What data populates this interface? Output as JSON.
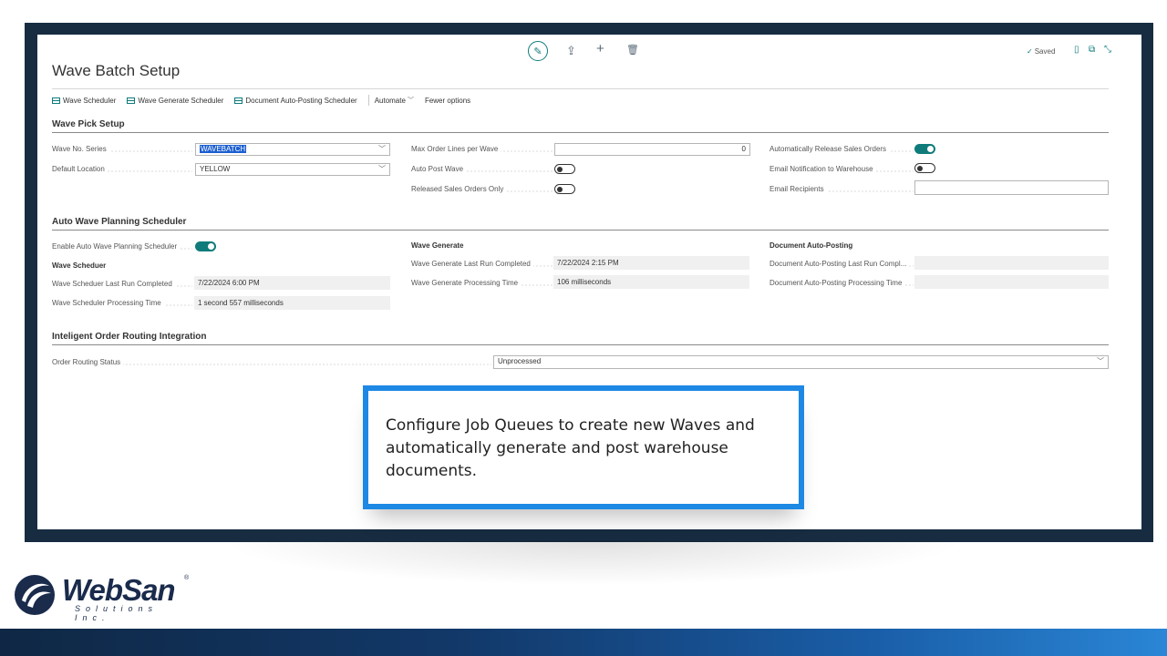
{
  "page": {
    "title": "Wave Batch Setup",
    "saved_label": "Saved"
  },
  "actions": {
    "wave_scheduler": "Wave Scheduler",
    "wave_generate_scheduler": "Wave Generate Scheduler",
    "document_auto_posting_scheduler": "Document Auto-Posting Scheduler",
    "automate": "Automate",
    "fewer_options": "Fewer options"
  },
  "wave_pick_setup": {
    "title": "Wave Pick Setup",
    "wave_no_series_label": "Wave No. Series",
    "wave_no_series_value": "WAVEBATCH",
    "default_location_label": "Default Location",
    "default_location_value": "YELLOW",
    "max_order_lines_label": "Max Order Lines per Wave",
    "max_order_lines_value": "0",
    "auto_post_wave_label": "Auto Post Wave",
    "auto_post_wave_on": false,
    "released_sales_orders_only_label": "Released Sales Orders Only",
    "released_sales_orders_only_on": false,
    "auto_release_label": "Automatically Release Sales Orders",
    "auto_release_on": true,
    "email_notification_label": "Email Notification to Warehouse",
    "email_notification_on": false,
    "email_recipients_label": "Email Recipients",
    "email_recipients_value": ""
  },
  "auto_wave": {
    "title": "Auto Wave Planning Scheduler",
    "enable_label": "Enable Auto Wave Planning Scheduler",
    "enable_on": true,
    "wave_scheduler_heading": "Wave Scheduer",
    "ws_last_run_label": "Wave Scheduer Last Run Completed",
    "ws_last_run_value": "7/22/2024 6:00 PM",
    "ws_processing_label": "Wave Scheduler Processing Time",
    "ws_processing_value": "1 second 557 milliseconds",
    "wave_generate_heading": "Wave Generate",
    "wg_last_run_label": "Wave Generate Last Run Completed",
    "wg_last_run_value": "7/22/2024 2:15 PM",
    "wg_processing_label": "Wave Generate Processing Time",
    "wg_processing_value": "106 milliseconds",
    "doc_posting_heading": "Document Auto-Posting",
    "dp_last_run_label": "Document Auto-Posting Last Run Compl...",
    "dp_last_run_value": "",
    "dp_processing_label": "Document Auto-Posting Processing Time",
    "dp_processing_value": ""
  },
  "routing": {
    "title": "Inteligent Order Routing Integration",
    "status_label": "Order Routing Status",
    "status_value": "Unprocessed"
  },
  "callout": {
    "text": "Configure Job Queues to create new Waves and automatically generate and post warehouse documents."
  },
  "logo": {
    "name": "WebSan",
    "tm": "®",
    "subtitle": "Solutions Inc."
  },
  "colors": {
    "frame": "#172c41",
    "accent_teal": "#0f7b7b",
    "callout_border": "#1e88e5"
  }
}
